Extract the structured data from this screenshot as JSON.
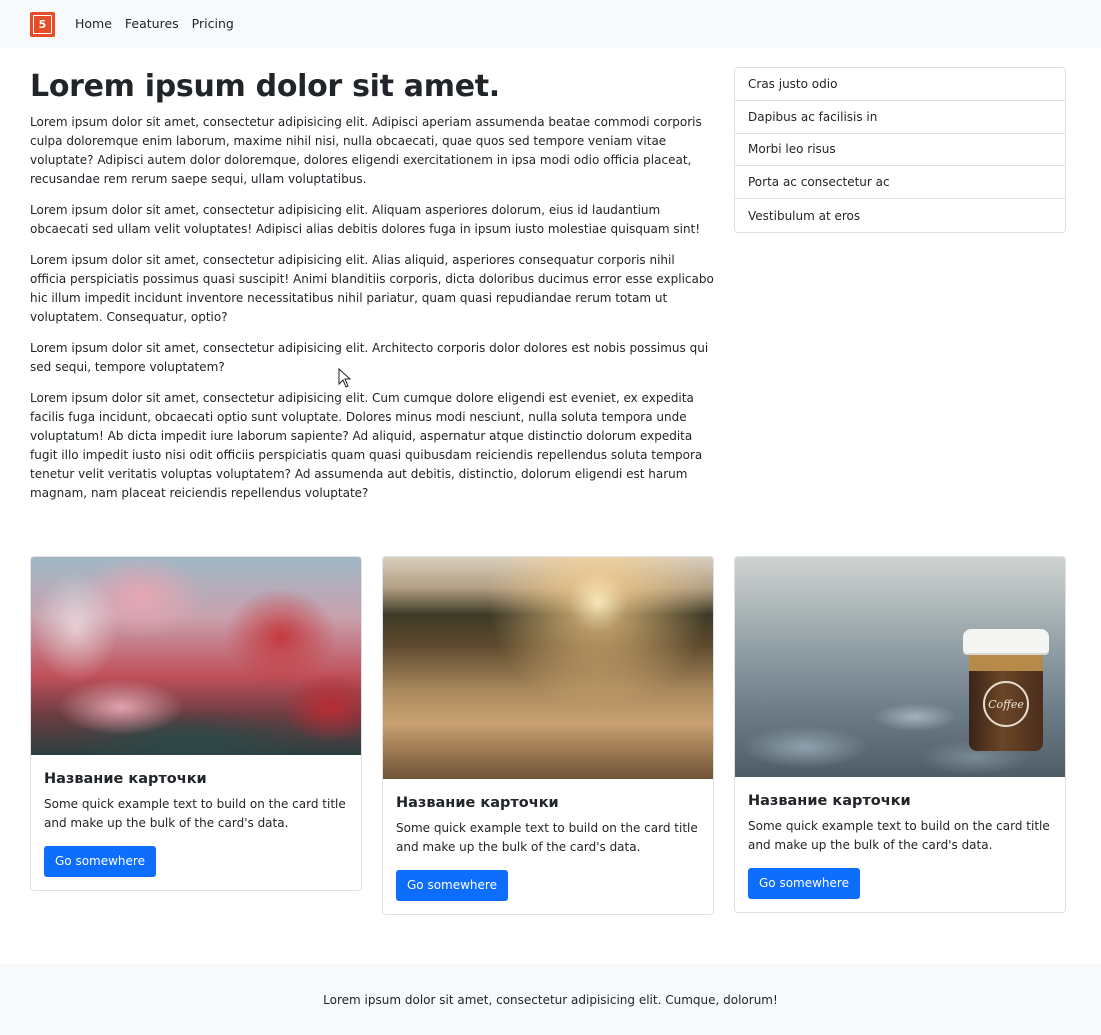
{
  "navbar": {
    "brand_icon": "html5-logo-icon",
    "brand_glyph": "5",
    "links": [
      {
        "label": "Home"
      },
      {
        "label": "Features"
      },
      {
        "label": "Pricing"
      }
    ]
  },
  "main": {
    "title": "Lorem ipsum dolor sit amet.",
    "paragraphs": [
      "Lorem ipsum dolor sit amet, consectetur adipisicing elit. Adipisci aperiam assumenda beatae commodi corporis culpa doloremque enim laborum, maxime nihil nisi, nulla obcaecati, quae quos sed tempore veniam vitae voluptate? Adipisci autem dolor doloremque, dolores eligendi exercitationem in ipsa modi odio officia placeat, recusandae rem rerum saepe sequi, ullam voluptatibus.",
      "Lorem ipsum dolor sit amet, consectetur adipisicing elit. Aliquam asperiores dolorum, eius id laudantium obcaecati sed ullam velit voluptates! Adipisci alias debitis dolores fuga in ipsum iusto molestiae quisquam sint!",
      "Lorem ipsum dolor sit amet, consectetur adipisicing elit. Alias aliquid, asperiores consequatur corporis nihil officia perspiciatis possimus quasi suscipit! Animi blanditiis corporis, dicta doloribus ducimus error esse explicabo hic illum impedit incidunt inventore necessitatibus nihil pariatur, quam quasi repudiandae rerum totam ut voluptatem. Consequatur, optio?",
      "Lorem ipsum dolor sit amet, consectetur adipisicing elit. Architecto corporis dolor dolores est nobis possimus qui sed sequi, tempore voluptatem?",
      "Lorem ipsum dolor sit amet, consectetur adipisicing elit. Cum cumque dolore eligendi est eveniet, ex expedita facilis fuga incidunt, obcaecati optio sunt voluptate. Dolores minus modi nesciunt, nulla soluta tempora unde voluptatum! Ab dicta impedit iure laborum sapiente? Ad aliquid, aspernatur atque distinctio dolorum expedita fugit illo impedit iusto nisi odit officiis perspiciatis quam quasi quibusdam reiciendis repellendus soluta tempora tenetur velit veritatis voluptas voluptatem? Ad assumenda aut debitis, distinctio, dolorum eligendi est harum magnam, nam placeat reiciendis repellendus voluptate?"
    ]
  },
  "sidebar": {
    "items": [
      {
        "label": "Cras justo odio"
      },
      {
        "label": "Dapibus ac facilisis in"
      },
      {
        "label": "Morbi leo risus"
      },
      {
        "label": "Porta ac consectetur ac"
      },
      {
        "label": "Vestibulum at eros"
      }
    ]
  },
  "cards": [
    {
      "title": "Название карточки",
      "text": "Some quick example text to build on the card title and make up the bulk of the card's data.",
      "button": "Go somewhere",
      "image": "red-autumn-trees-photo"
    },
    {
      "title": "Название карточки",
      "text": "Some quick example text to build on the card title and make up the bulk of the card's data.",
      "button": "Go somewhere",
      "image": "sunset-grass-field-photo"
    },
    {
      "title": "Название карточки",
      "text": "Some quick example text to build on the card title and make up the bulk of the card's data.",
      "button": "Go somewhere",
      "image": "coffee-cup-on-pebbles-photo",
      "cup_logo": "Coffee"
    }
  ],
  "footer": {
    "text": "Lorem ipsum dolor sit amet, consectetur adipisicing elit. Cumque, dolorum!"
  },
  "colors": {
    "primary": "#0d6efd",
    "navbar_bg": "#f8f9fa",
    "brand_orange": "#e44d26",
    "border": "#dee2e6",
    "text": "#212529"
  }
}
